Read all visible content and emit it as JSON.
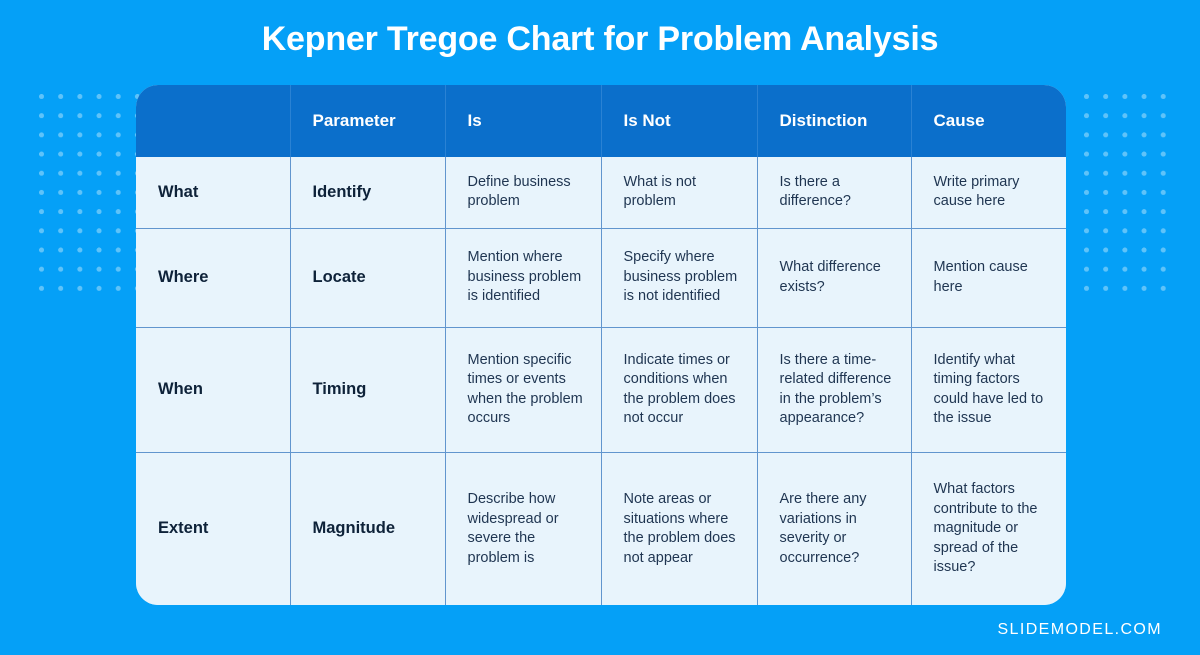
{
  "title": "Kepner Tregoe Chart for Problem Analysis",
  "footer": "SLIDEMODEL.COM",
  "colors": {
    "background": "#05A0F7",
    "header_row": "#0B6FCB",
    "card_body": "#E8F4FC",
    "divider": "#6195CE",
    "text_bold": "#0E2239",
    "text_body": "#1F3551",
    "dot_pattern": "#5FC3F9"
  },
  "chart_data": {
    "type": "table",
    "title": "Kepner Tregoe Chart for Problem Analysis",
    "columns": [
      "",
      "Parameter",
      "Is",
      "Is Not",
      "Distinction",
      "Cause"
    ],
    "rows": [
      {
        "label": "What",
        "parameter": "Identify",
        "is": "Define business problem",
        "is_not": "What is not problem",
        "distinction": "Is there a difference?",
        "cause": "Write primary cause here"
      },
      {
        "label": "Where",
        "parameter": "Locate",
        "is": "Mention where business problem is identified",
        "is_not": "Specify where business problem is not identified",
        "distinction": "What difference exists?",
        "cause": "Mention cause here"
      },
      {
        "label": "When",
        "parameter": "Timing",
        "is": "Mention specific times or events when the problem occurs",
        "is_not": "Indicate times or conditions when the problem does not occur",
        "distinction": "Is there a time-related difference in the problem’s appearance?",
        "cause": "Identify what timing factors could have led to the issue"
      },
      {
        "label": "Extent",
        "parameter": "Magnitude",
        "is": "Describe how widespread or severe the problem is",
        "is_not": "Note areas or situations where the problem does not appear",
        "distinction": "Are there any variations in severity or occurrence?",
        "cause": "What factors contribute to the magnitude or spread of the issue?"
      }
    ]
  }
}
